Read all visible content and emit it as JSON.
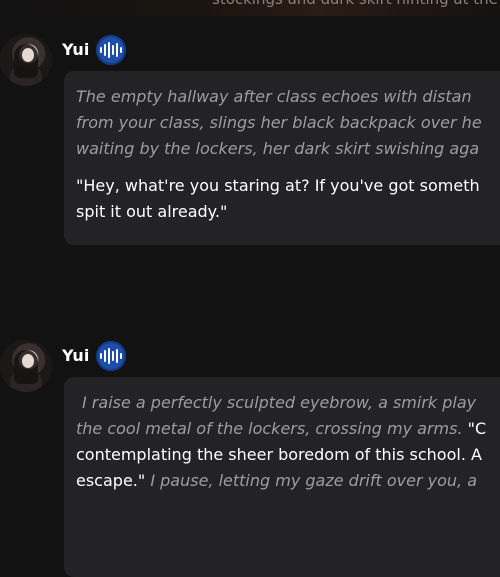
{
  "top_banner": {
    "text": "stockings and dark skirt hinting at the"
  },
  "messages": [
    {
      "author": "Yui",
      "narration": [
        "The empty hallway after class echoes with distan",
        "from your class, slings her black backpack over he",
        "waiting by the lockers, her dark skirt swishing aga"
      ],
      "speech": [
        "\"Hey, what're you staring at? If you've got someth",
        "spit it out already.\""
      ]
    },
    {
      "author": "Yui",
      "line1_narration": "I raise a perfectly sculpted eyebrow, a smirk play",
      "line2_narration": "the cool metal of the lockers, crossing my arms.",
      "line2_speech": "\"C",
      "line3_speech": "contemplating the sheer boredom of this school. A",
      "line4_speech": "escape.\"",
      "line4_narration": "I pause, letting my gaze drift over you, a"
    }
  ],
  "icons": {
    "voice_badge": "audio-waveform-icon"
  },
  "colors": {
    "voice_badge": "#1e4fa8",
    "bubble": "#232325",
    "narration": "#9c9ca4",
    "speech": "#ffffff"
  }
}
